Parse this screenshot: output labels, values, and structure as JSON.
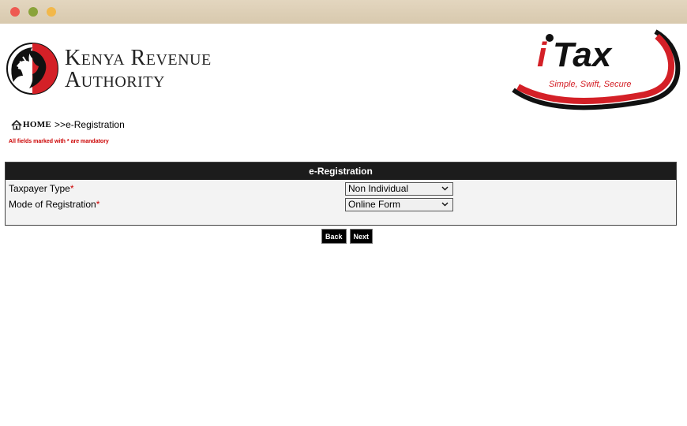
{
  "window": {
    "controls": [
      "close",
      "minimize",
      "zoom"
    ]
  },
  "header": {
    "kra_line1": "Kenya Revenue",
    "kra_line2": "Authority",
    "itax_brand": "iTax",
    "itax_tagline": "Simple, Swift, Secure",
    "colors": {
      "itax_red": "#d42027",
      "itax_black": "#111111"
    }
  },
  "breadcrumb": {
    "home": "HOME",
    "current": ">>e-Registration"
  },
  "mandatory_note": "All fields marked with * are mandatory",
  "form": {
    "title": "e-Registration",
    "required_mark": "*",
    "fields": [
      {
        "label": "Taxpayer Type",
        "value": "Non Individual"
      },
      {
        "label": "Mode of Registration",
        "value": "Online Form"
      }
    ]
  },
  "actions": {
    "back": "Back",
    "next": "Next"
  }
}
